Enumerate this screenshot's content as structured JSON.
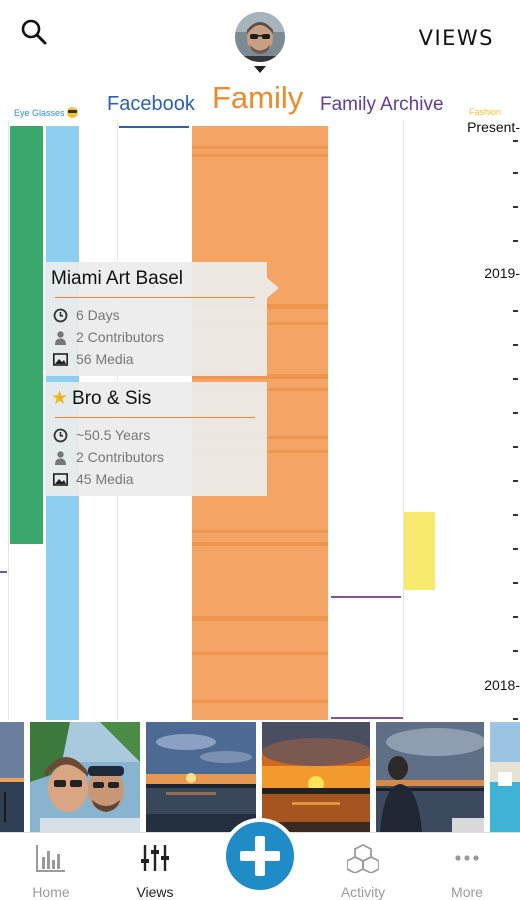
{
  "header": {
    "views_label": "VIEWS",
    "search_icon": "search-icon",
    "avatar_icon": "avatar"
  },
  "tabs": [
    {
      "label": "Eye Glasses",
      "color": "#2f8fdc"
    },
    {
      "label": "Facebook",
      "color": "#2b5fb8"
    },
    {
      "label": "Family",
      "color": "#ef8a2b",
      "active": true
    },
    {
      "label": "Family Archive",
      "color": "#5e3d9e"
    },
    {
      "label": "Fashion",
      "color": "#f1c232"
    }
  ],
  "timeline": {
    "axis_labels": [
      "Present-",
      "2019-",
      "2018-"
    ]
  },
  "cards": [
    {
      "title": "Miami Art Basel",
      "starred": false,
      "duration": "6 Days",
      "contributors": "2 Contributors",
      "media": "56 Media"
    },
    {
      "title": "Bro & Sis",
      "starred": true,
      "duration": "~50.5 Years",
      "contributors": "2 Contributors",
      "media": "45 Media"
    }
  ],
  "thumbnails": [
    "sunset-harbor-photo",
    "couple-selfie-photo",
    "sunset-water-photo",
    "orange-sunset-photo",
    "man-at-sunset-photo",
    "pool-photo"
  ],
  "nav": {
    "home": "Home",
    "views": "Views",
    "activity": "Activity",
    "more": "More",
    "active": "views"
  },
  "colors": {
    "accent": "#1f8cc7",
    "family": "#ef8a2b",
    "green_lane": "#3aa76d",
    "blue_lane": "#8ecff0",
    "yellow_lane": "#f7ea6e",
    "purple_line": "#7a52a8"
  }
}
